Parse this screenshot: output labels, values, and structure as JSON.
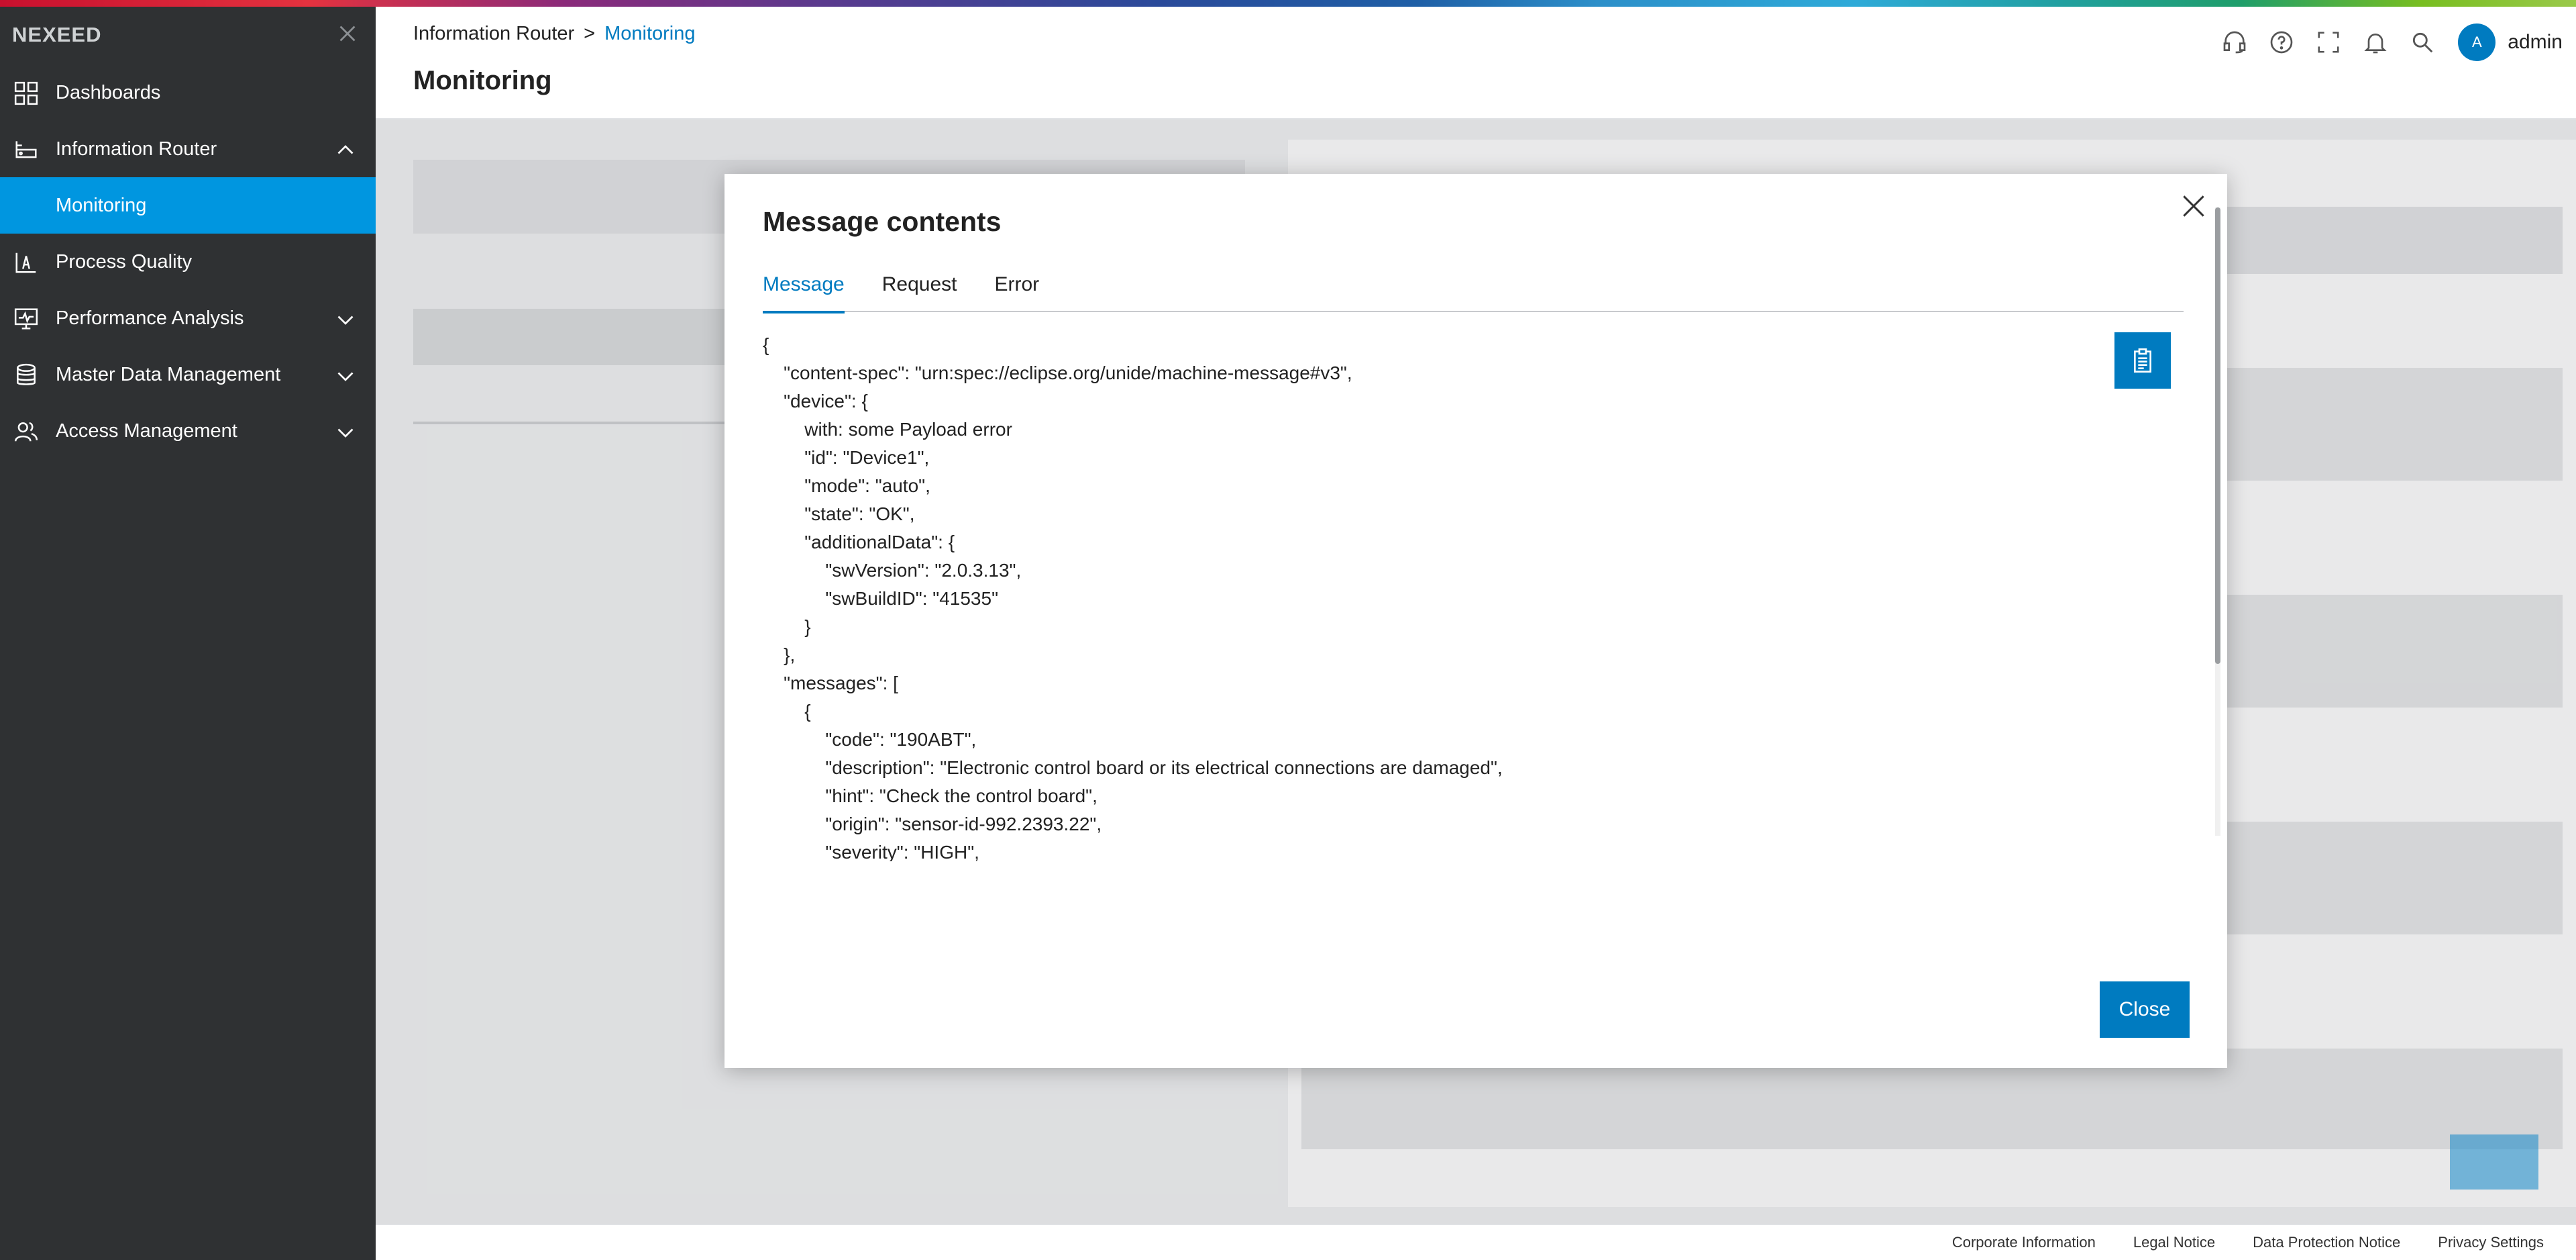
{
  "app": {
    "brand": "NEXEED"
  },
  "sidebar": {
    "items": [
      {
        "label": "Dashboards",
        "icon": "dashboard-grid-icon"
      },
      {
        "label": "Information Router",
        "icon": "router-icon",
        "expanded": true
      },
      {
        "label": "Monitoring",
        "active": true
      },
      {
        "label": "Process Quality",
        "icon": "process-quality-icon"
      },
      {
        "label": "Performance Analysis",
        "icon": "performance-monitor-icon"
      },
      {
        "label": "Master Data Management",
        "icon": "database-icon"
      },
      {
        "label": "Access Management",
        "icon": "users-icon"
      }
    ]
  },
  "header": {
    "breadcrumb": {
      "parent": "Information Router",
      "separator": ">",
      "current": "Monitoring"
    },
    "title": "Monitoring",
    "user": {
      "initial": "A",
      "name": "admin"
    }
  },
  "modal": {
    "title": "Message contents",
    "tabs": [
      {
        "label": "Message",
        "active": true
      },
      {
        "label": "Request"
      },
      {
        "label": "Error"
      }
    ],
    "content": "{\n    \"content-spec\": \"urn:spec://eclipse.org/unide/machine-message#v3\",\n    \"device\": {\n        with: some Payload error\n        \"id\": \"Device1\",\n        \"mode\": \"auto\",\n        \"state\": \"OK\",\n        \"additionalData\": {\n            \"swVersion\": \"2.0.3.13\",\n            \"swBuildID\": \"41535\"\n        }\n    },\n    \"messages\": [\n        {\n            \"code\": \"190ABT\",\n            \"description\": \"Electronic control board or its electrical connections are damaged\",\n            \"hint\": \"Check the control board\",\n            \"origin\": \"sensor-id-992.2393.22\",\n            \"severity\": \"HIGH\",\n            \"source\": \"DEVICE\",\n            \"state\": \"NEW\",\n            \"title\": \"control board damaged\",",
    "close_label": "Close"
  },
  "footer": {
    "links": [
      "Corporate Information",
      "Legal Notice",
      "Data Protection Notice",
      "Privacy Settings"
    ]
  },
  "colors": {
    "accent": "#007bc0",
    "sidebar_bg": "#2f3133",
    "active_nav": "#0096e0"
  }
}
